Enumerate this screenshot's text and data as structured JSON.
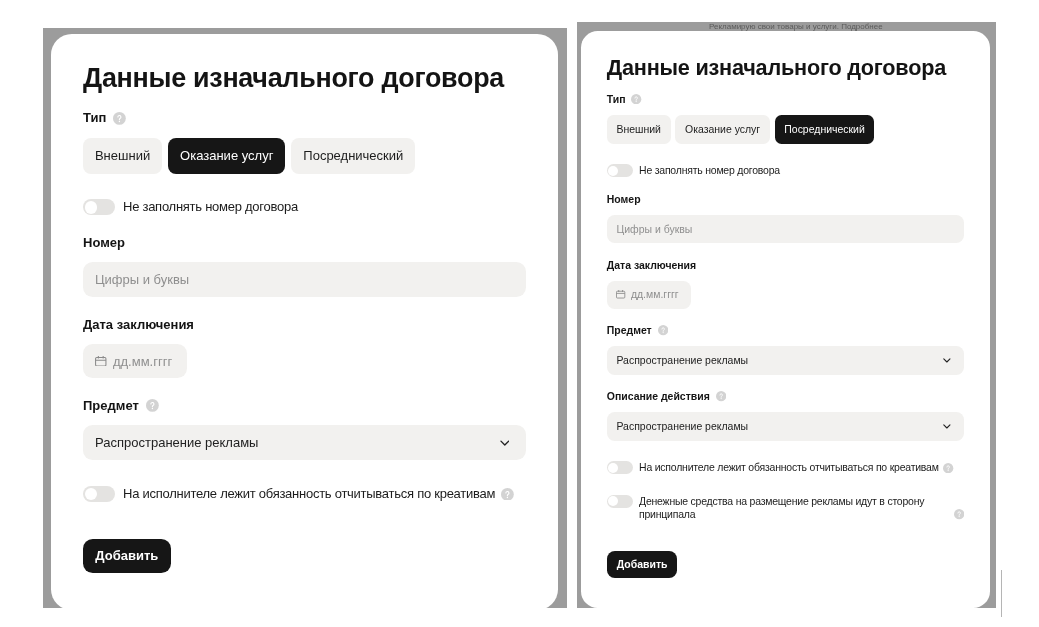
{
  "screens": [
    {
      "dialog": {
        "title": "Данные изначального договора",
        "fields": [
          {
            "kind": "segmented",
            "label": "Тип",
            "help": true,
            "options": [
              {
                "label": "Внешний",
                "selected": false
              },
              {
                "label": "Оказание услуг",
                "selected": true
              },
              {
                "label": "Посреднический",
                "selected": false
              }
            ]
          },
          {
            "kind": "toggle",
            "label": "Не заполнять номер договора",
            "on": false,
            "help": false
          },
          {
            "kind": "text",
            "label": "Номер",
            "placeholder": "Цифры и буквы"
          },
          {
            "kind": "date",
            "label": "Дата заключения",
            "placeholder": "дд.мм.гггг"
          },
          {
            "kind": "select",
            "label": "Предмет",
            "help": true,
            "value": "Распространение рекламы"
          },
          {
            "kind": "toggle",
            "label": "На исполнителе лежит обязанность отчитываться по креативам",
            "on": false,
            "help": true
          }
        ],
        "button": "Добавить"
      }
    },
    {
      "backdrop_text": "Рекламирую свои товары и услуги. Подробнее",
      "dialog": {
        "title": "Данные изначального договора",
        "fields": [
          {
            "kind": "segmented",
            "label": "Тип",
            "help": true,
            "options": [
              {
                "label": "Внешний",
                "selected": false
              },
              {
                "label": "Оказание услуг",
                "selected": false
              },
              {
                "label": "Посреднический",
                "selected": true
              }
            ]
          },
          {
            "kind": "toggle",
            "label": "Не заполнять номер договора",
            "on": false,
            "help": false
          },
          {
            "kind": "text",
            "label": "Номер",
            "placeholder": "Цифры и буквы"
          },
          {
            "kind": "date",
            "label": "Дата заключения",
            "placeholder": "дд.мм.гггг"
          },
          {
            "kind": "select",
            "label": "Предмет",
            "help": true,
            "value": "Распространение рекламы"
          },
          {
            "kind": "select",
            "label": "Описание действия",
            "help": true,
            "value": "Распространение рекламы"
          },
          {
            "kind": "toggle",
            "label": "На исполнителе лежит обязанность отчитываться по креативам",
            "on": false,
            "help": true
          },
          {
            "kind": "toggle",
            "label": "Денежные средства на размещение рекламы идут в сторону принципала",
            "on": false,
            "help": true
          }
        ],
        "button": "Добавить"
      }
    }
  ]
}
